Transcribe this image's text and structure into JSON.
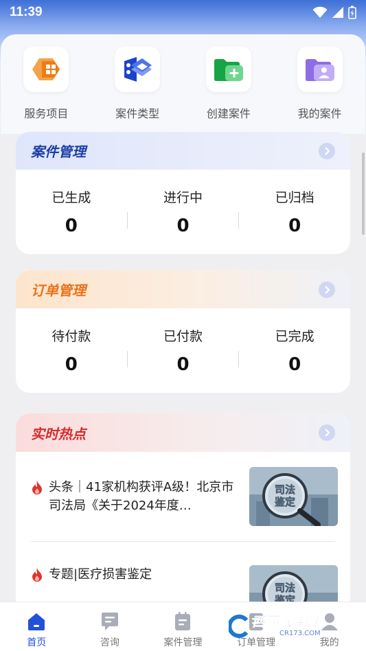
{
  "status_bar": {
    "time": "11:39"
  },
  "quick_actions": [
    {
      "label": "服务项目",
      "icon": "service-items-icon",
      "color": "#f08a24"
    },
    {
      "label": "案件类型",
      "icon": "case-types-icon",
      "color": "#2a55d9"
    },
    {
      "label": "创建案件",
      "icon": "create-case-icon",
      "color": "#1fb24c"
    },
    {
      "label": "我的案件",
      "icon": "my-cases-icon",
      "color": "#8b6be8"
    }
  ],
  "case_management": {
    "title": "案件管理",
    "stats": [
      {
        "label": "已生成",
        "value": "0"
      },
      {
        "label": "进行中",
        "value": "0"
      },
      {
        "label": "已归档",
        "value": "0"
      }
    ]
  },
  "order_management": {
    "title": "订单管理",
    "stats": [
      {
        "label": "待付款",
        "value": "0"
      },
      {
        "label": "已付款",
        "value": "0"
      },
      {
        "label": "已完成",
        "value": "0"
      }
    ]
  },
  "hot_news": {
    "title": "实时热点",
    "items": [
      {
        "title": "头条｜41家机构获评A级！北京市司法局《关于2024年度…",
        "thumb_text": "司法鉴定"
      },
      {
        "title": "专题|医疗损害鉴定",
        "thumb_text": "司法鉴定"
      }
    ]
  },
  "tabbar": [
    {
      "label": "首页",
      "active": true
    },
    {
      "label": "咨询",
      "active": false
    },
    {
      "label": "案件管理",
      "active": false
    },
    {
      "label": "订单管理",
      "active": false
    },
    {
      "label": "我的",
      "active": false
    }
  ],
  "watermark": {
    "text": "西西软件园",
    "sub": "CR173.COM"
  },
  "colors": {
    "accent": "#2350d8",
    "case_title": "#1d3fa8",
    "order_title": "#e8721a",
    "hot_title": "#d62d2d"
  }
}
